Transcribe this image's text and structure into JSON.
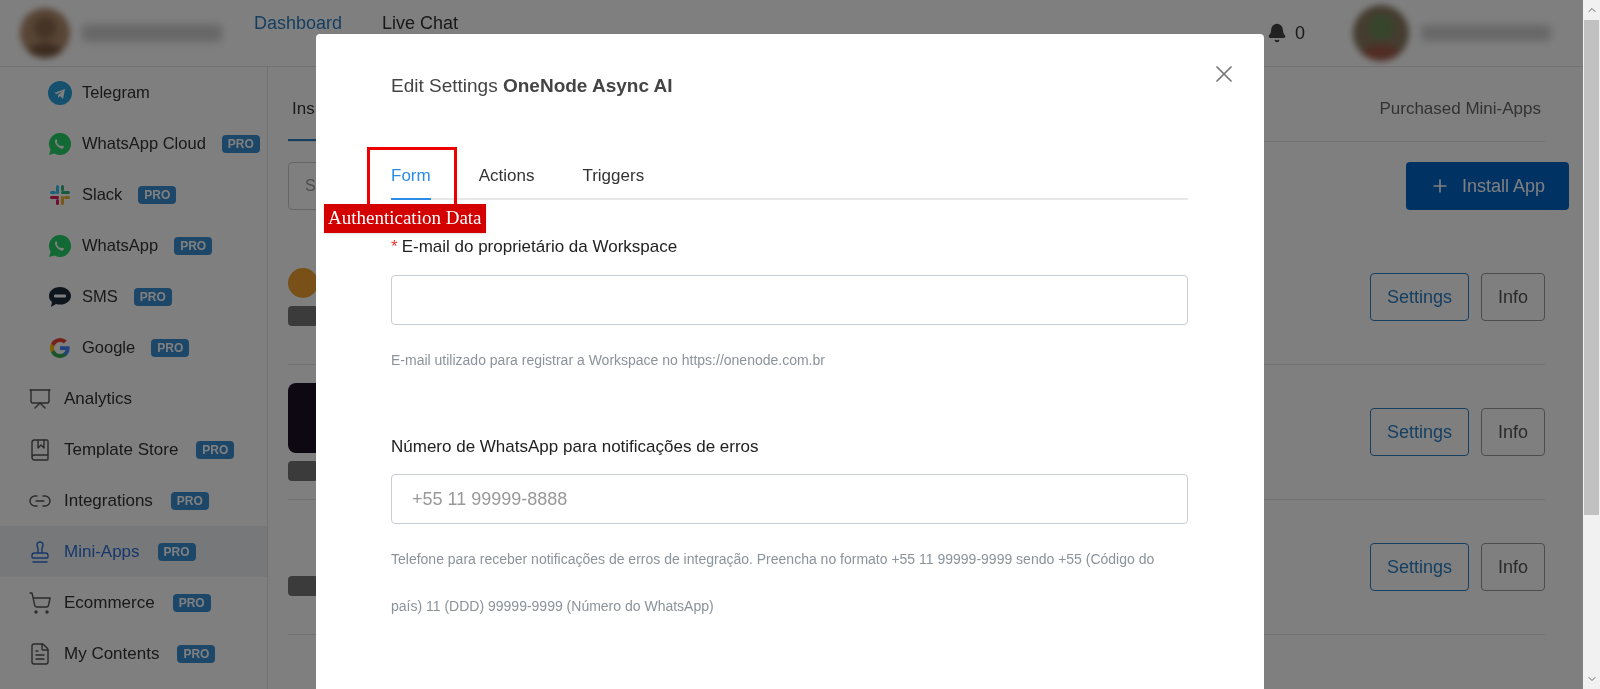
{
  "header": {
    "nav": [
      {
        "label": "Dashboard",
        "selected": true
      },
      {
        "label": "Live Chat",
        "selected": false
      }
    ],
    "notifications": "0"
  },
  "sidebar": {
    "channels": [
      {
        "label": "Telegram"
      },
      {
        "label": "WhatsApp Cloud",
        "badge": "PRO"
      },
      {
        "label": "Slack",
        "badge": "PRO"
      },
      {
        "label": "WhatsApp",
        "badge": "PRO"
      },
      {
        "label": "SMS",
        "badge": "PRO"
      },
      {
        "label": "Google",
        "badge": "PRO"
      }
    ],
    "items": [
      {
        "label": "Analytics",
        "selected": false
      },
      {
        "label": "Template Store",
        "badge": "PRO",
        "selected": false
      },
      {
        "label": "Integrations",
        "badge": "PRO",
        "selected": false
      },
      {
        "label": "Mini-Apps",
        "badge": "PRO",
        "selected": true
      },
      {
        "label": "Ecommerce",
        "badge": "PRO",
        "selected": false
      },
      {
        "label": "My Contents",
        "badge": "PRO",
        "selected": false
      }
    ]
  },
  "main": {
    "tabs": [
      {
        "label": "Ins",
        "selected": true
      },
      {
        "label": "Purchased Mini-Apps",
        "selected": false
      }
    ],
    "search": {
      "placeholder": "S"
    },
    "install_button": "Install App",
    "rows": [
      {
        "settings": "Settings",
        "info": "Info"
      },
      {
        "settings": "Settings",
        "info": "Info"
      },
      {
        "settings": "Settings",
        "info": "Info"
      }
    ]
  },
  "modal": {
    "title": "Edit Settings **OneNode Async AI**",
    "tabs": [
      {
        "label": "Form",
        "selected": true
      },
      {
        "label": "Actions",
        "selected": false
      },
      {
        "label": "Triggers",
        "selected": false
      }
    ],
    "fields": [
      {
        "label": "E-mail do proprietário da Workspace",
        "required": true,
        "required_mark": "*",
        "help": "E-mail utilizado para registrar a Workspace no https://onenode.com.br"
      },
      {
        "label": "Número de WhatsApp para notificações de erros",
        "required": false,
        "placeholder": "+55 11 99999-8888",
        "help": "Telefone para receber notificações de erros de integração. Preencha no formato +55 11 99999-9999 sendo +55 (Código do país) 11 (DDD) 99999-9999 (Número do WhatsApp)"
      }
    ]
  },
  "annotation": {
    "label": "Authentication Data"
  }
}
